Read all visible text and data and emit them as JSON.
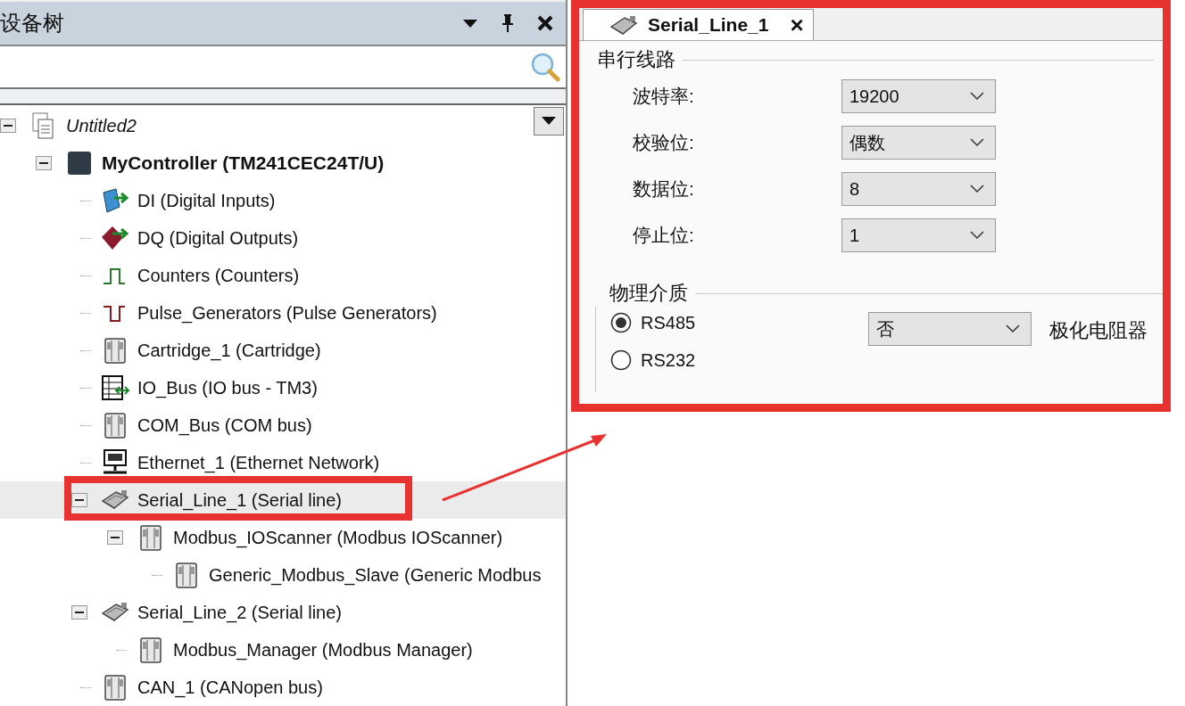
{
  "device_panel": {
    "title": "设备树",
    "tree": [
      {
        "label": "Untitled2",
        "kind": "project",
        "expanded": true,
        "selected": false,
        "children": [
          {
            "label": "MyController (TM241CEC24T/U)",
            "kind": "controller",
            "expanded": true,
            "selected": false,
            "children": [
              {
                "label": "DI (Digital Inputs)",
                "kind": "input",
                "selected": false
              },
              {
                "label": "DQ (Digital Outputs)",
                "kind": "output",
                "selected": false
              },
              {
                "label": "Counters (Counters)",
                "kind": "counter",
                "selected": false
              },
              {
                "label": "Pulse_Generators (Pulse Generators)",
                "kind": "pulse",
                "selected": false
              },
              {
                "label": "Cartridge_1 (Cartridge)",
                "kind": "module",
                "selected": false
              },
              {
                "label": "IO_Bus (IO bus - TM3)",
                "kind": "bus",
                "selected": false
              },
              {
                "label": "COM_Bus (COM bus)",
                "kind": "module",
                "selected": false
              },
              {
                "label": "Ethernet_1 (Ethernet Network)",
                "kind": "ethernet",
                "selected": false
              },
              {
                "label": "Serial_Line_1 (Serial line)",
                "kind": "serial",
                "expanded": true,
                "selected": true,
                "highlighted": true,
                "children": [
                  {
                    "label": "Modbus_IOScanner (Modbus IOScanner)",
                    "kind": "module",
                    "expanded": true,
                    "selected": false,
                    "children": [
                      {
                        "label": "Generic_Modbus_Slave (Generic Modbus",
                        "kind": "module",
                        "selected": false
                      }
                    ]
                  }
                ]
              },
              {
                "label": "Serial_Line_2 (Serial line)",
                "kind": "serial",
                "expanded": true,
                "selected": false,
                "children": [
                  {
                    "label": "Modbus_Manager (Modbus Manager)",
                    "kind": "module",
                    "selected": false
                  }
                ]
              },
              {
                "label": "CAN_1 (CANopen bus)",
                "kind": "module",
                "selected": false
              }
            ]
          }
        ]
      }
    ]
  },
  "editor": {
    "highlighted": true,
    "tab": {
      "label": "Serial_Line_1",
      "close": "×"
    },
    "serial_group": {
      "title": "串行线路",
      "fields": [
        {
          "label": "波特率:",
          "value": "19200"
        },
        {
          "label": "校验位:",
          "value": "偶数"
        },
        {
          "label": "数据位:",
          "value": "8"
        },
        {
          "label": "停止位:",
          "value": "1"
        }
      ]
    },
    "medium_group": {
      "title": "物理介质",
      "options": [
        {
          "label": "RS485",
          "selected": true
        },
        {
          "label": "RS232",
          "selected": false
        }
      ],
      "polarization": {
        "value": "否",
        "label": "极化电阻器"
      }
    }
  }
}
